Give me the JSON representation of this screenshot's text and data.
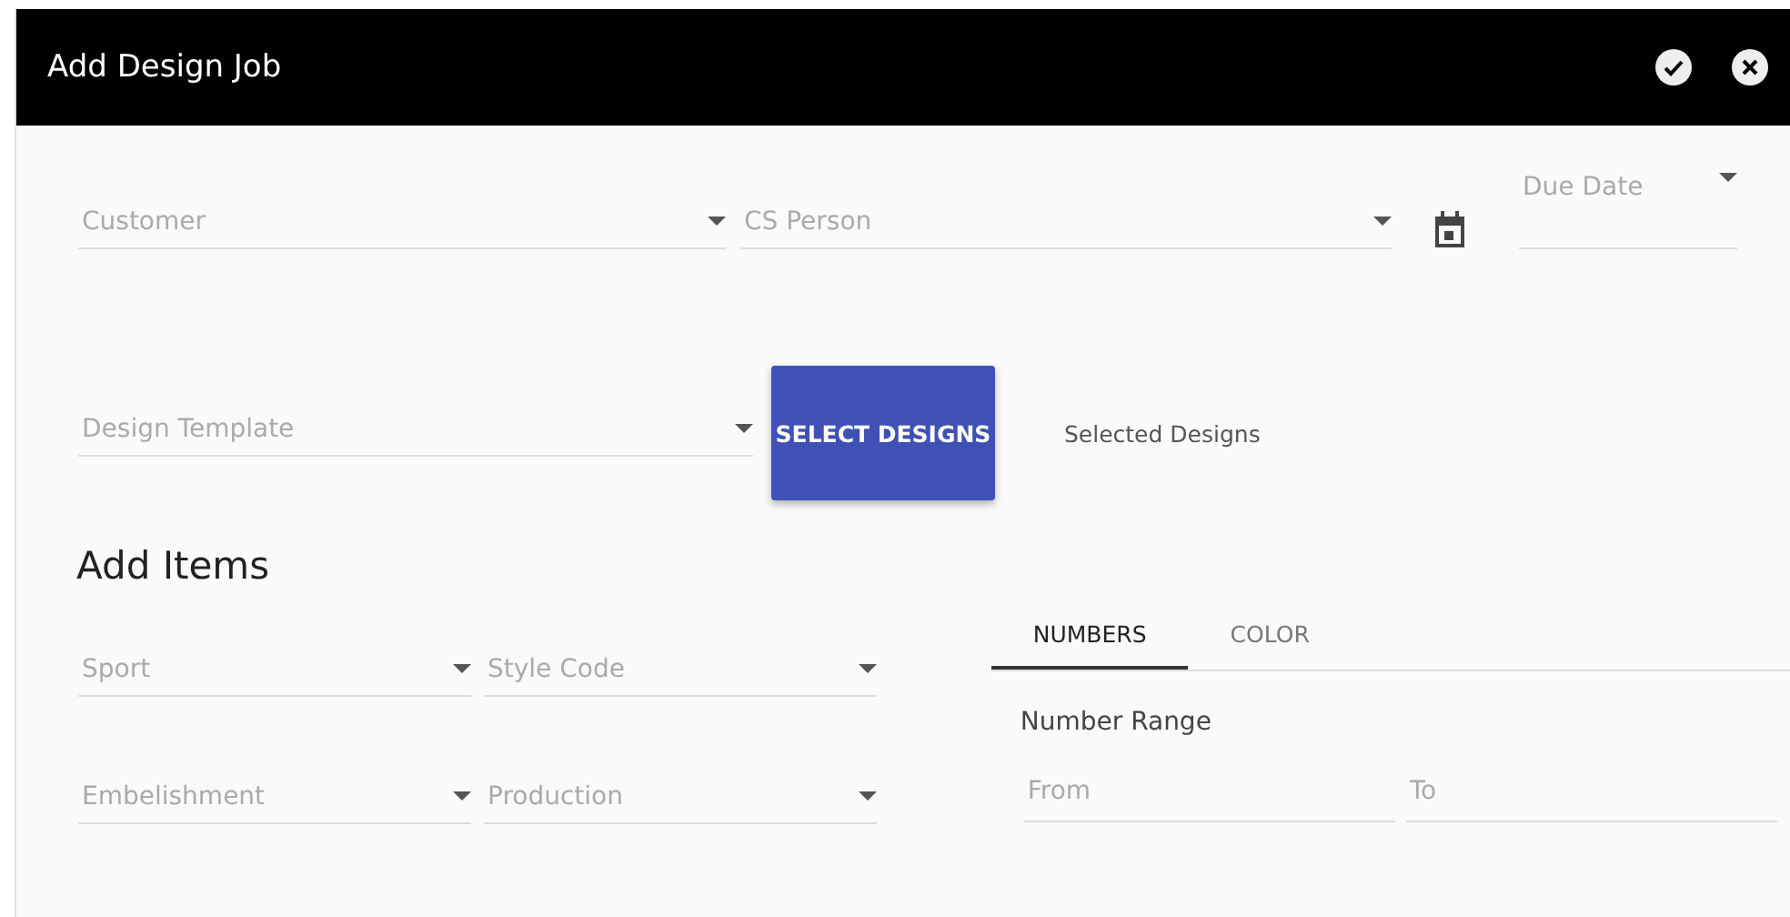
{
  "window": {
    "title": "Add Design Job"
  },
  "job_fields": [
    {
      "placeholder": "Customer"
    },
    {
      "placeholder": "CS Person"
    }
  ],
  "due_date": {
    "placeholder": "Due Date"
  },
  "design_template": {
    "placeholder": "Design Template"
  },
  "select_designs_button": "SELECT DESIGNS",
  "selected_designs": "Selected Designs",
  "add_items": {
    "heading": "Add Items",
    "fields": [
      {
        "placeholder": "Sport"
      },
      {
        "placeholder": "Style Code"
      },
      {
        "placeholder": "Embelishment"
      },
      {
        "placeholder": "Production"
      }
    ],
    "tabs": [
      {
        "label": "NUMBERS",
        "selected": true
      },
      {
        "label": "COLOR",
        "selected": false
      }
    ],
    "number_range": {
      "label": "Number Range",
      "from": {
        "placeholder": "From"
      },
      "to": {
        "placeholder": "To"
      }
    }
  }
}
